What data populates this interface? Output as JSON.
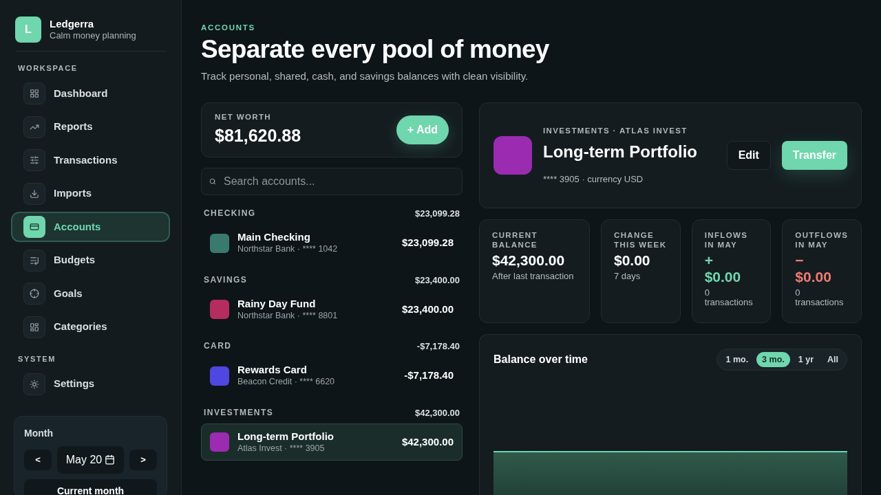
{
  "brand": {
    "logo_letter": "L",
    "name": "Ledgerra",
    "tagline": "Calm money planning"
  },
  "sidebar": {
    "sections": [
      {
        "title": "WORKSPACE",
        "items": [
          {
            "label": "Dashboard",
            "selected": false
          },
          {
            "label": "Reports",
            "selected": false
          },
          {
            "label": "Transactions",
            "selected": false
          },
          {
            "label": "Imports",
            "selected": false
          },
          {
            "label": "Accounts",
            "selected": true
          },
          {
            "label": "Budgets",
            "selected": false
          },
          {
            "label": "Goals",
            "selected": false
          },
          {
            "label": "Categories",
            "selected": false
          }
        ]
      },
      {
        "title": "SYSTEM",
        "items": [
          {
            "label": "Settings",
            "selected": false
          }
        ]
      }
    ],
    "month_picker": {
      "title": "Month",
      "prev": "<",
      "value": "May 20",
      "next": ">",
      "current_button": "Current month"
    }
  },
  "header": {
    "eyebrow": "ACCOUNTS",
    "title": "Separate every pool of money",
    "subtitle": "Track personal, shared, cash, and savings balances with clean visibility."
  },
  "net_worth": {
    "label": "NET WORTH",
    "value": "$81,620.88",
    "add_button": "+ Add"
  },
  "search": {
    "placeholder": "Search accounts..."
  },
  "groups": [
    {
      "title": "CHECKING",
      "total": "$23,099.28",
      "accounts": [
        {
          "name": "Main Checking",
          "detail": "Northstar Bank · **** 1042",
          "balance": "$23,099.28",
          "color": "#3a7a6e",
          "selected": false
        }
      ]
    },
    {
      "title": "SAVINGS",
      "total": "$23,400.00",
      "accounts": [
        {
          "name": "Rainy Day Fund",
          "detail": "Northstar Bank · **** 8801",
          "balance": "$23,400.00",
          "color": "#b52d5e",
          "selected": false
        }
      ]
    },
    {
      "title": "CARD",
      "total": "-$7,178.40",
      "accounts": [
        {
          "name": "Rewards Card",
          "detail": "Beacon Credit · **** 6620",
          "balance": "-$7,178.40",
          "color": "#5046e0",
          "selected": false
        }
      ]
    },
    {
      "title": "INVESTMENTS",
      "total": "$42,300.00",
      "accounts": [
        {
          "name": "Long-term Portfolio",
          "detail": "Atlas Invest · **** 3905",
          "balance": "$42,300.00",
          "color": "#9b2bb0",
          "selected": true
        }
      ]
    }
  ],
  "detail": {
    "eyebrow": "INVESTMENTS · ATLAS INVEST",
    "name": "Long-term Portfolio",
    "color": "#9b2bb0",
    "meta": "**** 3905 · currency USD",
    "edit_button": "Edit",
    "transfer_button": "Transfer"
  },
  "stats": [
    {
      "label": "CURRENT BALANCE",
      "kind": "neutral",
      "value": "$42,300.00",
      "note": "After last transaction"
    },
    {
      "label": "CHANGE THIS WEEK",
      "kind": "neutral",
      "value": "$0.00",
      "note": "7 days"
    },
    {
      "label": "INFLOWS IN MAY",
      "kind": "positive",
      "sign": "+",
      "value": "$0.00",
      "note": "0 transactions"
    },
    {
      "label": "OUTFLOWS IN MAY",
      "kind": "negative",
      "sign": "−",
      "value": "$0.00",
      "note": "0 transactions"
    }
  ],
  "balance_chart": {
    "title": "Balance over time",
    "ranges": [
      {
        "label": "1 mo.",
        "selected": false
      },
      {
        "label": "3 mo.",
        "selected": true
      },
      {
        "label": "1 yr",
        "selected": false
      },
      {
        "label": "All",
        "selected": false
      }
    ]
  }
}
